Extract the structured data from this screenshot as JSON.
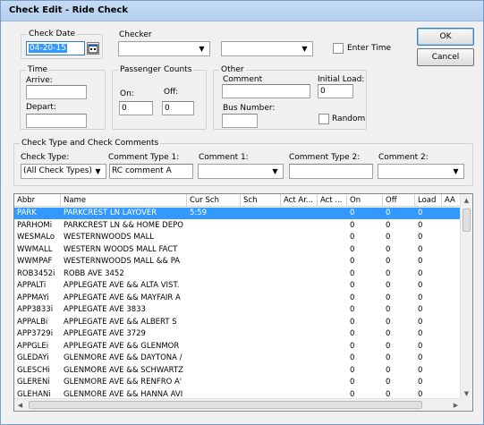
{
  "window": {
    "title": "Check Edit - Ride Check"
  },
  "check_date": {
    "label": "Check Date",
    "value": "04-20-15",
    "calendar_icon": "calendar-icon"
  },
  "checker": {
    "label": "Checker",
    "value1": "",
    "value2": ""
  },
  "enter_time": {
    "label": "Enter Time",
    "checked": false
  },
  "buttons": {
    "ok": "OK",
    "cancel": "Cancel"
  },
  "time": {
    "label": "Time",
    "arrive_label": "Arrive:",
    "arrive_value": "",
    "depart_label": "Depart:",
    "depart_value": ""
  },
  "passenger_counts": {
    "label": "Passenger Counts",
    "on_label": "On:",
    "on_value": "0",
    "off_label": "Off:",
    "off_value": "0"
  },
  "other": {
    "label": "Other",
    "comment_label": "Comment",
    "comment_value": "",
    "initial_load_label": "Initial Load:",
    "initial_load_value": "0",
    "bus_number_label": "Bus Number:",
    "bus_number_value": "",
    "random_label": "Random",
    "random_checked": false
  },
  "check_type_group": {
    "label": "Check Type and Check Comments",
    "check_type_label": "Check Type:",
    "check_type_value": "(All Check Types)",
    "comment_type1_label": "Comment Type 1:",
    "comment_type1_value": "RC comment A",
    "comment1_label": "Comment 1:",
    "comment1_value": "",
    "comment_type2_label": "Comment Type 2:",
    "comment_type2_value": "",
    "comment2_label": "Comment 2:",
    "comment2_value": ""
  },
  "grid": {
    "columns": [
      "Abbr",
      "Name",
      "Cur Sch",
      "Sch",
      "Act Ar...",
      "Act ...",
      "On",
      "Off",
      "Load",
      "AA"
    ],
    "rows": [
      {
        "abbr": "PARK",
        "name": "PARKCREST LN LAYOVER",
        "cur_sch": "5:59",
        "on": "0",
        "off": "0",
        "load": "0",
        "selected": true
      },
      {
        "abbr": "PARHOMi",
        "name": "PARKCREST LN && HOME DEPO",
        "cur_sch": "",
        "on": "0",
        "off": "0",
        "load": "0",
        "selected": false
      },
      {
        "abbr": "WESMALo",
        "name": "WESTERNWOODS MALL",
        "cur_sch": "",
        "on": "0",
        "off": "0",
        "load": "0",
        "selected": false
      },
      {
        "abbr": "WWMALL",
        "name": "WESTERN WOODS MALL FACT",
        "cur_sch": "",
        "on": "0",
        "off": "0",
        "load": "0",
        "selected": false
      },
      {
        "abbr": "WWMPAF",
        "name": "WESTERNWOODS MALL && PA",
        "cur_sch": "",
        "on": "0",
        "off": "0",
        "load": "0",
        "selected": false
      },
      {
        "abbr": "ROB3452i",
        "name": "ROBB AVE 3452",
        "cur_sch": "",
        "on": "0",
        "off": "0",
        "load": "0",
        "selected": false
      },
      {
        "abbr": "APPALTi",
        "name": "APPLEGATE AVE && ALTA VIST.",
        "cur_sch": "",
        "on": "0",
        "off": "0",
        "load": "0",
        "selected": false
      },
      {
        "abbr": "APPMAYi",
        "name": "APPLEGATE AVE && MAYFAIR A",
        "cur_sch": "",
        "on": "0",
        "off": "0",
        "load": "0",
        "selected": false
      },
      {
        "abbr": "APP3833i",
        "name": "APPLEGATE AVE 3833",
        "cur_sch": "",
        "on": "0",
        "off": "0",
        "load": "0",
        "selected": false
      },
      {
        "abbr": "APPALBi",
        "name": "APPLEGATE AVE && ALBERT S",
        "cur_sch": "",
        "on": "0",
        "off": "0",
        "load": "0",
        "selected": false
      },
      {
        "abbr": "APP3729i",
        "name": "APPLEGATE AVE 3729",
        "cur_sch": "",
        "on": "0",
        "off": "0",
        "load": "0",
        "selected": false
      },
      {
        "abbr": "APPGLEi",
        "name": "APPLEGATE AVE && GLENMOR",
        "cur_sch": "",
        "on": "0",
        "off": "0",
        "load": "0",
        "selected": false
      },
      {
        "abbr": "GLEDAYi",
        "name": "GLENMORE AVE && DAYTONA /",
        "cur_sch": "",
        "on": "0",
        "off": "0",
        "load": "0",
        "selected": false
      },
      {
        "abbr": "GLESCHi",
        "name": "GLENMORE AVE && SCHWARTZ",
        "cur_sch": "",
        "on": "0",
        "off": "0",
        "load": "0",
        "selected": false
      },
      {
        "abbr": "GLERENi",
        "name": "GLENMORE AVE && RENFRO A'",
        "cur_sch": "",
        "on": "0",
        "off": "0",
        "load": "0",
        "selected": false
      },
      {
        "abbr": "GLEHANi",
        "name": "GLENMORE AVE && HANNA AVI",
        "cur_sch": "",
        "on": "0",
        "off": "0",
        "load": "0",
        "selected": false
      }
    ]
  }
}
